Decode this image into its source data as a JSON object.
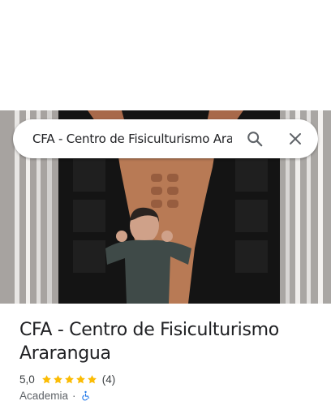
{
  "search": {
    "query": "CFA - Centro de Fisiculturismo Ararangua"
  },
  "icons": {
    "search": "search-icon",
    "close": "close-icon",
    "star": "star-icon",
    "accessibility": "wheelchair-icon"
  },
  "place": {
    "title": "CFA - Centro de Fisiculturismo Ararangua",
    "rating": "5,0",
    "stars": 5,
    "review_count": "(4)",
    "category": "Academia",
    "separator": "·"
  },
  "colors": {
    "star": "#fbbc04",
    "accessibility_icon": "#1a73e8",
    "title": "#202124",
    "secondary": "#5f6368"
  }
}
